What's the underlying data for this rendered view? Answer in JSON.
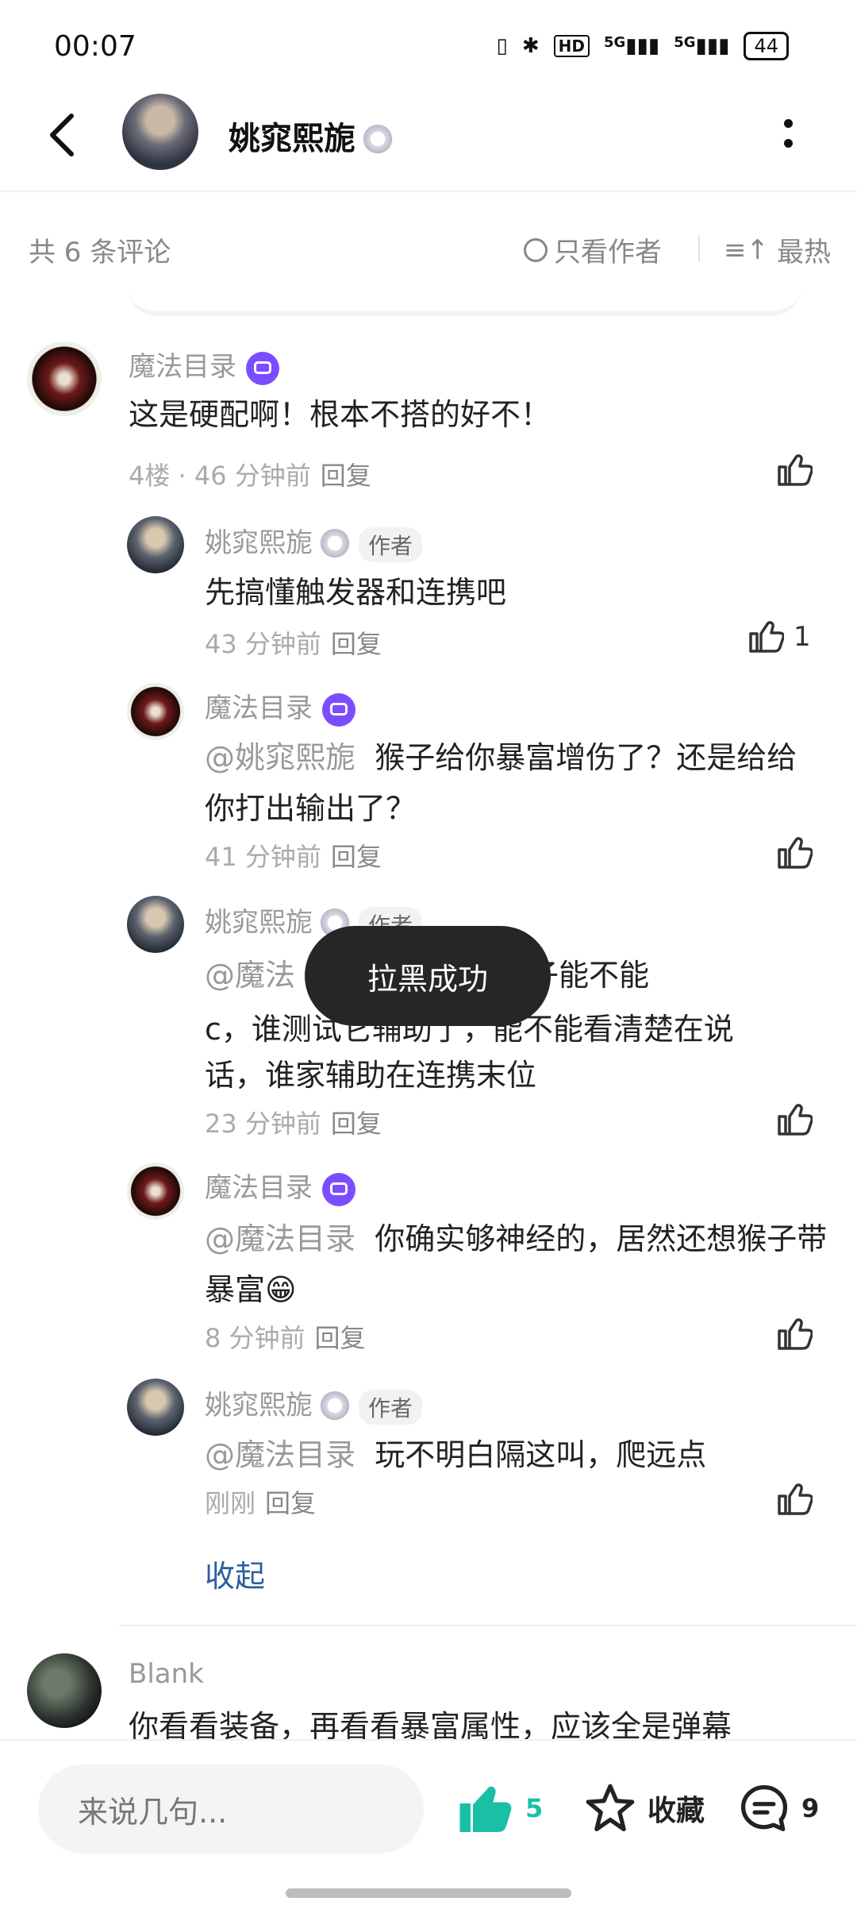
{
  "status": {
    "time": "00:07",
    "battery": "44",
    "hd": "HD",
    "net1": "5G",
    "net2": "5G"
  },
  "header": {
    "title": "姚窕熙旎"
  },
  "filter": {
    "count": "共 6 条评论",
    "only_author": "只看作者",
    "sort": "最热"
  },
  "comments": [
    {
      "user": "魔法目录",
      "text": "这是硬配啊！根本不搭的好不！",
      "floor": "4楼 · 46 分钟前",
      "reply": "回复"
    },
    {
      "user": "姚窕熙旎",
      "tag": "作者",
      "text": "先搞懂触发器和连携吧",
      "time": "43 分钟前",
      "reply": "回复",
      "likes": "1"
    },
    {
      "user": "魔法目录",
      "mention": "@姚窕熙旎",
      "text": "猴子给你暴富增伤了？还是给给你打出输出了？",
      "time": "41 分钟前",
      "reply": "回复"
    },
    {
      "user": "姚窕熙旎",
      "tag": "作者",
      "mention": "@魔法",
      "text_a": "测试猴子能不能",
      "text_b": "c，谁测试它辅助了，能不能看清楚在说",
      "text_c": "话，谁家辅助在连携末位",
      "time": "23 分钟前",
      "reply": "回复"
    },
    {
      "user": "魔法目录",
      "mention": "@魔法目录",
      "text": "你确实够神经的，居然还想猴子带暴富😁",
      "time": "8 分钟前",
      "reply": "回复"
    },
    {
      "user": "姚窕熙旎",
      "tag": "作者",
      "mention": "@魔法目录",
      "text": "玩不明白隔这叫，爬远点",
      "time": "刚刚",
      "reply": "回复"
    },
    {
      "user": "Blank",
      "text": "你看看装备，再看看暴富属性，应该全是弹幕"
    }
  ],
  "collapse": "收起",
  "toast": "拉黑成功",
  "bottom": {
    "placeholder": "来说几句...",
    "likes": "5",
    "fav": "收藏",
    "comments": "9"
  },
  "colors": {
    "accent": "#19c0a6",
    "link": "#2a5f9e",
    "badge": "#7c4dff"
  }
}
